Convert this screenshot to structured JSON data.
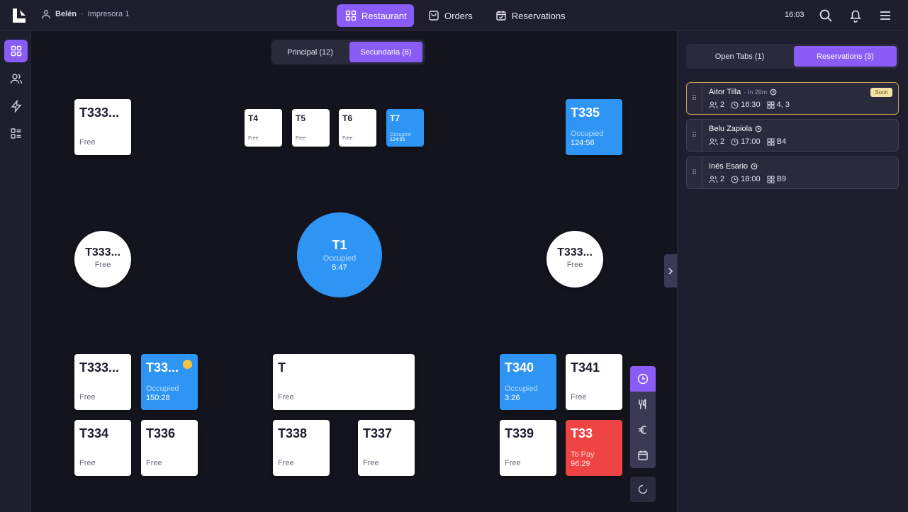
{
  "header": {
    "user": "Belén",
    "separator": "·",
    "printer": "Impresora 1",
    "nav": [
      {
        "label": "Restaurant",
        "icon": "grid-icon",
        "active": true
      },
      {
        "label": "Orders",
        "icon": "bag-icon",
        "active": false
      },
      {
        "label": "Reservations",
        "icon": "calendar-check-icon",
        "active": false
      }
    ],
    "clock": "16:03"
  },
  "sidebar": {
    "items": [
      "grid-icon",
      "users-icon",
      "bolt-icon",
      "list-icon"
    ]
  },
  "floor": {
    "zones": [
      {
        "label": "Principal (12)",
        "active": false
      },
      {
        "label": "Secundaria (6)",
        "active": true
      }
    ],
    "tables": {
      "t333a": {
        "name": "T333...",
        "status": "Free"
      },
      "t4": {
        "name": "T4",
        "status": "Free"
      },
      "t5": {
        "name": "T5",
        "status": "Free"
      },
      "t6": {
        "name": "T6",
        "status": "Free"
      },
      "t7": {
        "name": "T7",
        "status": "Occupied",
        "time": "124:55"
      },
      "t335": {
        "name": "T335",
        "status": "Occupied",
        "time": "124:56"
      },
      "round_left": {
        "name": "T333...",
        "status": "Free"
      },
      "t1": {
        "name": "T1",
        "status": "Occupied",
        "time": "5:47"
      },
      "round_right": {
        "name": "T333...",
        "status": "Free"
      },
      "t333b": {
        "name": "T333...",
        "status": "Free"
      },
      "t33occ": {
        "name": "T33...",
        "status": "Occupied",
        "time": "150:28"
      },
      "t_long": {
        "name": "T",
        "status": "Free"
      },
      "t340": {
        "name": "T340",
        "status": "Occupied",
        "time": "3:26"
      },
      "t341": {
        "name": "T341",
        "status": "Free"
      },
      "t334": {
        "name": "T334",
        "status": "Free"
      },
      "t336": {
        "name": "T336",
        "status": "Free"
      },
      "t338": {
        "name": "T338",
        "status": "Free"
      },
      "t337": {
        "name": "T337",
        "status": "Free"
      },
      "t339": {
        "name": "T339",
        "status": "Free"
      },
      "t33pay": {
        "name": "T33",
        "status": "To Pay",
        "time": "96:29"
      }
    },
    "tools": [
      "clock-icon",
      "cutlery-icon",
      "euro-icon",
      "calendar-icon"
    ]
  },
  "panel": {
    "tabs": [
      {
        "label": "Open Tabs (1)",
        "active": false
      },
      {
        "label": "Reservations (3)",
        "active": true
      }
    ],
    "reservations": [
      {
        "name": "Aitor Tilla",
        "in": "· In 26m",
        "people": "2",
        "time": "16:30",
        "tables": "4, 3",
        "badge": "Soon"
      },
      {
        "name": "Belu Zapiola",
        "people": "2",
        "time": "17:00",
        "tables": "B4"
      },
      {
        "name": "Inés Esario",
        "people": "2",
        "time": "18:00",
        "tables": "B9"
      }
    ]
  },
  "colors": {
    "accent": "#8a5cf6",
    "occupied": "#2f95f5",
    "to_pay": "#ef4444",
    "background": "#14141f",
    "surface": "#1e1e2e"
  }
}
